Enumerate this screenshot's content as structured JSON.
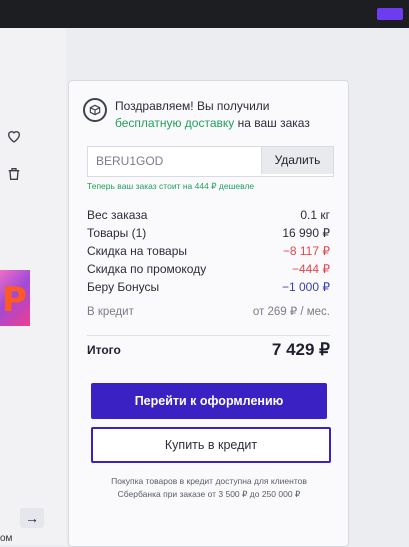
{
  "promo": {
    "message_before": "Поздравляем! Вы получили ",
    "message_link": "бесплатную доставку",
    "message_after": " на ваш заказ",
    "code_value": "BERU1GOD",
    "delete_label": "Удалить",
    "saving_text": "Теперь ваш заказ стоит на 444 ₽ дешевле"
  },
  "summary": {
    "rows": [
      {
        "label": "Вес заказа",
        "value": "0.1 кг"
      },
      {
        "label": "Товары (1)",
        "value": "16 990 ₽"
      },
      {
        "label": "Скидка на товары",
        "value": "−8 117 ₽"
      },
      {
        "label": "Скидка по промокоду",
        "value": "−444 ₽"
      },
      {
        "label": "Беру Бонусы",
        "value": "−1 000 ₽"
      }
    ],
    "credit_label": "В кредит",
    "credit_value": "от 269 ₽ / мес.",
    "total_label": "Итого",
    "total_value": "7 429 ₽"
  },
  "actions": {
    "checkout_label": "Перейти к оформлению",
    "credit_buy_label": "Купить в кредит"
  },
  "footer_note": "Покупка товаров в кредит доступна для клиентов Сбербанка при заказе от 3 500 ₽ до 250 000 ₽",
  "left": {
    "thumb_letter": "P",
    "arrow": "→",
    "cut_text": "ом"
  },
  "colors": {
    "accent": "#3a21c4",
    "green": "#21a15b",
    "discount_red": "#e0464e"
  }
}
